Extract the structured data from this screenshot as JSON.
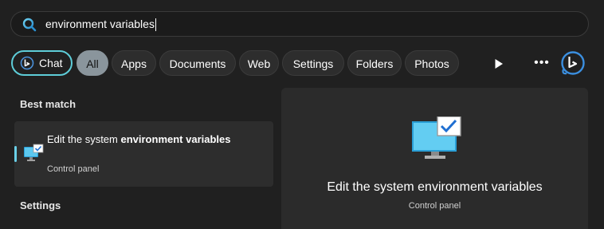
{
  "search": {
    "value": "environment variables"
  },
  "filters": {
    "chat": "Chat",
    "items": [
      "All",
      "Apps",
      "Documents",
      "Web",
      "Settings",
      "Folders",
      "Photos"
    ],
    "active": "All"
  },
  "toolbar_icons": [
    "play-icon",
    "more-icon",
    "bing-icon"
  ],
  "sections": {
    "best_match": "Best match",
    "settings": "Settings"
  },
  "best_match_result": {
    "title_prefix": "Edit the system ",
    "title_bold": "environment variables",
    "subtitle": "Control panel",
    "icon": "system-properties-monitor-icon"
  },
  "preview": {
    "title": "Edit the system environment variables",
    "subtitle": "Control panel",
    "icon": "system-properties-monitor-icon"
  },
  "colors": {
    "background": "#202020",
    "accent": "#5ecdd8",
    "active_pill": "#8a959c",
    "card": "#2d2d2d"
  }
}
